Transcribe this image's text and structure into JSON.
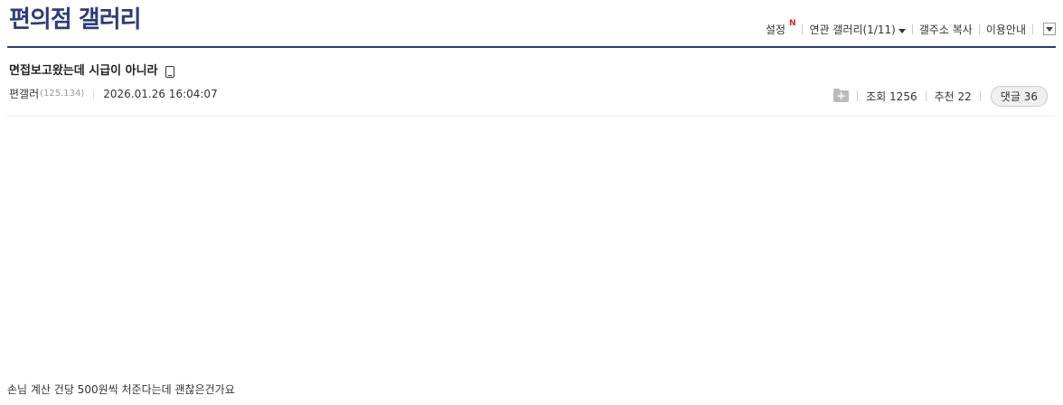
{
  "gallery": {
    "title": "편의점 갤러리"
  },
  "top_menu": {
    "settings": "설정",
    "new_badge": "N",
    "related": "연관 갤러리(1/11)",
    "copy_address": "갤주소 복사",
    "guide": "이용안내"
  },
  "post": {
    "title": "면접보고왔는데 시급이 아니라",
    "author": "편갤러",
    "ip": "(125.134)",
    "datetime": "2026.01.26 16:04:07",
    "views_label": "조회",
    "views": "1256",
    "recommend_label": "추천",
    "recommend": "22",
    "comments_label": "댓글",
    "comments": "36",
    "body": "손님 계산 건당 500원씩 처준다는데 괜찮은건가요"
  },
  "colors": {
    "accent": "#2c3e7a",
    "badge": "#e02020"
  },
  "icons": [
    "mobile-icon",
    "folder-add-icon",
    "dropdown-arrow-icon"
  ]
}
